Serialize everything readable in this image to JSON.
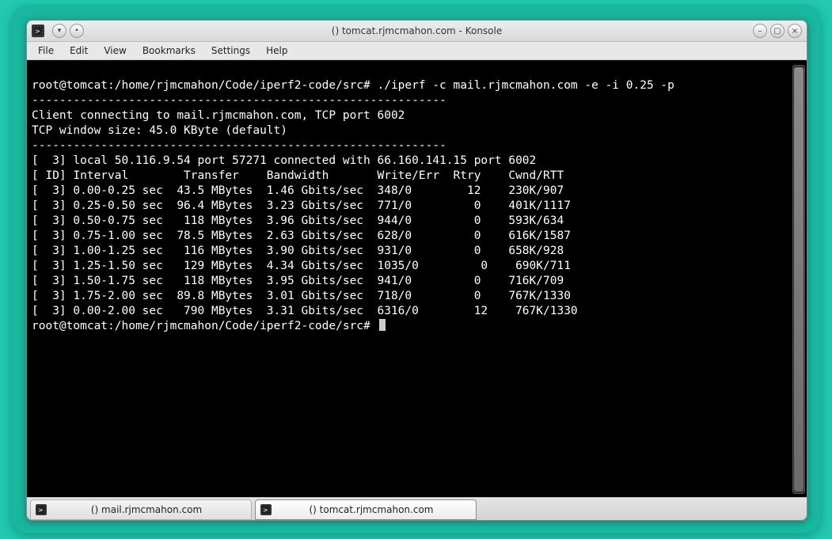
{
  "window": {
    "title": "() tomcat.rjmcmahon.com - Konsole"
  },
  "menubar": {
    "file": "File",
    "edit": "Edit",
    "view": "View",
    "bookmarks": "Bookmarks",
    "settings": "Settings",
    "help": "Help"
  },
  "terminal": {
    "l0": "root@tomcat:/home/rjmcmahon/Code/iperf2-code/src# ./iperf -c mail.rjmcmahon.com -e -i 0.25 -p ",
    "l1": "------------------------------------------------------------",
    "l2": "Client connecting to mail.rjmcmahon.com, TCP port 6002",
    "l3": "TCP window size: 45.0 KByte (default)",
    "l4": "------------------------------------------------------------",
    "l5": "[  3] local 50.116.9.54 port 57271 connected with 66.160.141.15 port 6002",
    "l6": "[ ID] Interval        Transfer    Bandwidth       Write/Err  Rtry    Cwnd/RTT",
    "l7": "[  3] 0.00-0.25 sec  43.5 MBytes  1.46 Gbits/sec  348/0        12    230K/907",
    "l8": "[  3] 0.25-0.50 sec  96.4 MBytes  3.23 Gbits/sec  771/0         0    401K/1117",
    "l9": "[  3] 0.50-0.75 sec   118 MBytes  3.96 Gbits/sec  944/0         0    593K/634",
    "l10": "[  3] 0.75-1.00 sec  78.5 MBytes  2.63 Gbits/sec  628/0         0    616K/1587",
    "l11": "[  3] 1.00-1.25 sec   116 MBytes  3.90 Gbits/sec  931/0         0    658K/928",
    "l12": "[  3] 1.25-1.50 sec   129 MBytes  4.34 Gbits/sec  1035/0         0    690K/711",
    "l13": "[  3] 1.50-1.75 sec   118 MBytes  3.95 Gbits/sec  941/0         0    716K/709",
    "l14": "[  3] 1.75-2.00 sec  89.8 MBytes  3.01 Gbits/sec  718/0         0    767K/1330",
    "l15": "[  3] 0.00-2.00 sec   790 MBytes  3.31 Gbits/sec  6316/0        12    767K/1330",
    "prompt": "root@tomcat:/home/rjmcmahon/Code/iperf2-code/src# "
  },
  "tabs": {
    "t0": {
      "label": "() mail.rjmcmahon.com",
      "active": false
    },
    "t1": {
      "label": "() tomcat.rjmcmahon.com",
      "active": true
    }
  }
}
